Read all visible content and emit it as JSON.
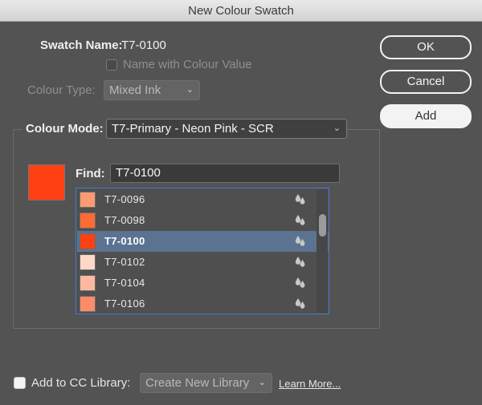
{
  "window": {
    "title": "New Colour Swatch"
  },
  "swatch_name": {
    "label": "Swatch Name:",
    "value": "T7-0100"
  },
  "name_with_value": {
    "label": "Name with Colour Value"
  },
  "colour_type": {
    "label": "Colour Type:",
    "value": "Mixed Ink"
  },
  "colour_mode": {
    "label": "Colour Mode:",
    "value": "T7-Primary - Neon Pink - SCR"
  },
  "preview": {
    "color": "#ff4013"
  },
  "find": {
    "label": "Find:",
    "value": "T7-0100"
  },
  "swatch_list": [
    {
      "name": "T7-0096",
      "color": "#fd9a72",
      "icon": "ink-drops-icon"
    },
    {
      "name": "T7-0098",
      "color": "#ff6a33",
      "icon": "ink-drops-icon"
    },
    {
      "name": "T7-0100",
      "color": "#ff4013",
      "icon": "ink-drops-icon",
      "selected": true
    },
    {
      "name": "T7-0102",
      "color": "#fdd8c8",
      "icon": "ink-drops-icon"
    },
    {
      "name": "T7-0104",
      "color": "#fcb9a0",
      "icon": "ink-drops-icon"
    },
    {
      "name": "T7-0106",
      "color": "#fc8c68",
      "icon": "ink-drops-icon"
    }
  ],
  "buttons": {
    "ok": "OK",
    "cancel": "Cancel",
    "add": "Add"
  },
  "cc_library": {
    "label": "Add to CC Library:",
    "dropdown": "Create New Library",
    "learn_more": "Learn More..."
  },
  "colors": {
    "accent_border": "#3d7fd1",
    "selection": "#5b7391"
  }
}
